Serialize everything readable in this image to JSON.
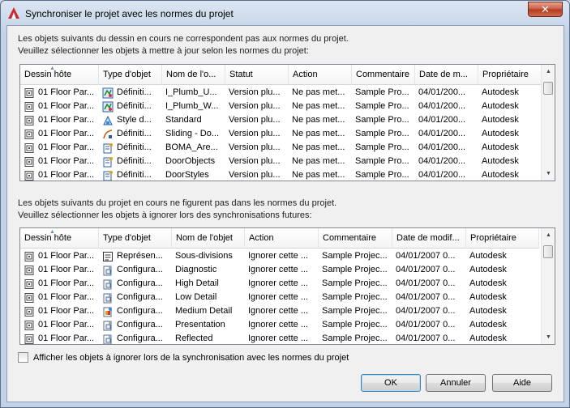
{
  "window": {
    "title": "Synchroniser le projet avec les normes du projet",
    "close_glyph": "✕",
    "accent_color": "#cc2a2a"
  },
  "top_section": {
    "line1": "Les objets suivants du dessin en cours ne correspondent pas aux normes du projet.",
    "line2": "Veuillez sélectionner les objets à mettre à jour selon les normes du projet:",
    "columns": [
      "Dessin hôte",
      "Type d'objet",
      "Nom de l'o...",
      "Statut",
      "Action",
      "Commentaire",
      "Date de m...",
      "Propriétaire"
    ],
    "rows": [
      {
        "host": "01 Floor Par...",
        "type": "Définiti...",
        "type_icon": "plumbing-style-icon",
        "name": "I_Plumb_U...",
        "status": "Version plu...",
        "action": "Ne pas met...",
        "comment": "Sample Pro...",
        "date": "04/01/200...",
        "owner": "Autodesk"
      },
      {
        "host": "01 Floor Par...",
        "type": "Définiti...",
        "type_icon": "plumbing-style-icon",
        "name": "I_Plumb_W...",
        "status": "Version plu...",
        "action": "Ne pas met...",
        "comment": "Sample Pro...",
        "date": "04/01/200...",
        "owner": "Autodesk"
      },
      {
        "host": "01 Floor Par...",
        "type": "Style d...",
        "type_icon": "style-icon",
        "name": "Standard",
        "status": "Version plu...",
        "action": "Ne pas met...",
        "comment": "Sample Pro...",
        "date": "04/01/200...",
        "owner": "Autodesk"
      },
      {
        "host": "01 Floor Par...",
        "type": "Définiti...",
        "type_icon": "sliding-door-icon",
        "name": "Sliding - Do...",
        "status": "Version plu...",
        "action": "Ne pas met...",
        "comment": "Sample Pro...",
        "date": "04/01/200...",
        "owner": "Autodesk"
      },
      {
        "host": "01 Floor Par...",
        "type": "Définiti...",
        "type_icon": "definition-icon",
        "name": "BOMA_Are...",
        "status": "Version plu...",
        "action": "Ne pas met...",
        "comment": "Sample Pro...",
        "date": "04/01/200...",
        "owner": "Autodesk"
      },
      {
        "host": "01 Floor Par...",
        "type": "Définiti...",
        "type_icon": "definition-icon",
        "name": "DoorObjects",
        "status": "Version plu...",
        "action": "Ne pas met...",
        "comment": "Sample Pro...",
        "date": "04/01/200...",
        "owner": "Autodesk"
      },
      {
        "host": "01 Floor Par...",
        "type": "Définiti...",
        "type_icon": "definition-icon",
        "name": "DoorStyles",
        "status": "Version plu...",
        "action": "Ne pas met...",
        "comment": "Sample Pro...",
        "date": "04/01/200...",
        "owner": "Autodesk"
      }
    ]
  },
  "bottom_section": {
    "line1": "Les objets suivants du projet en cours ne figurent pas dans les normes du projet.",
    "line2": "Veuillez sélectionner les objets à ignorer lors des synchronisations futures:",
    "columns": [
      "Dessin hôte",
      "Type d'objet",
      "Nom de l'objet",
      "Action",
      "Commentaire",
      "Date de modif...",
      "Propriétaire"
    ],
    "rows": [
      {
        "host": "01 Floor Par...",
        "type": "Représen...",
        "type_icon": "representation-icon",
        "name": "Sous-divisions",
        "action": "Ignorer cette ...",
        "comment": "Sample Projec...",
        "date": "04/01/2007 0...",
        "owner": "Autodesk"
      },
      {
        "host": "01 Floor Par...",
        "type": "Configura...",
        "type_icon": "configuration-icon",
        "name": "Diagnostic",
        "action": "Ignorer cette ...",
        "comment": "Sample Projec...",
        "date": "04/01/2007 0...",
        "owner": "Autodesk"
      },
      {
        "host": "01 Floor Par...",
        "type": "Configura...",
        "type_icon": "configuration-icon",
        "name": "High Detail",
        "action": "Ignorer cette ...",
        "comment": "Sample Projec...",
        "date": "04/01/2007 0...",
        "owner": "Autodesk"
      },
      {
        "host": "01 Floor Par...",
        "type": "Configura...",
        "type_icon": "configuration-icon",
        "name": "Low Detail",
        "action": "Ignorer cette ...",
        "comment": "Sample Projec...",
        "date": "04/01/2007 0...",
        "owner": "Autodesk"
      },
      {
        "host": "01 Floor Par...",
        "type": "Configura...",
        "type_icon": "configuration-color-icon",
        "name": "Medium Detail",
        "action": "Ignorer cette ...",
        "comment": "Sample Projec...",
        "date": "04/01/2007 0...",
        "owner": "Autodesk"
      },
      {
        "host": "01 Floor Par...",
        "type": "Configura...",
        "type_icon": "configuration-icon",
        "name": "Presentation",
        "action": "Ignorer cette ...",
        "comment": "Sample Projec...",
        "date": "04/01/2007 0...",
        "owner": "Autodesk"
      },
      {
        "host": "01 Floor Par...",
        "type": "Configura...",
        "type_icon": "configuration-icon",
        "name": "Reflected",
        "action": "Ignorer cette ...",
        "comment": "Sample Projec...",
        "date": "04/01/2007 0...",
        "owner": "Autodesk"
      }
    ]
  },
  "options": {
    "show_ignored_label": "Afficher les objets à ignorer lors de la synchronisation avec les normes du projet",
    "show_ignored_checked": false
  },
  "buttons": {
    "ok": "OK",
    "cancel": "Annuler",
    "help": "Aide"
  },
  "scroll_glyphs": {
    "up": "▲",
    "down": "▼"
  }
}
